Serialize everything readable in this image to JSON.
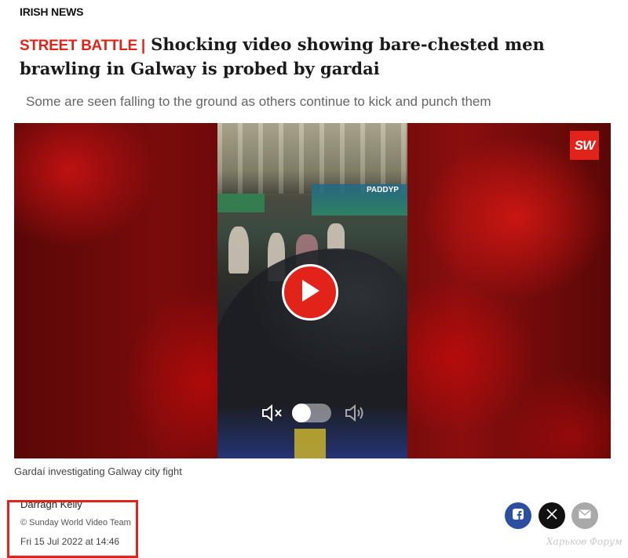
{
  "section": {
    "label": "IRISH NEWS"
  },
  "article": {
    "kicker": "STREET BATTLE |",
    "headline": "Shocking video showing bare-chested men brawling in Galway is probed by gardai",
    "standfirst": "Some are seen falling to the ground as others continue to kick and punch them"
  },
  "video": {
    "logo_text": "SW",
    "sign_text": "PADDYP",
    "caption": "Gardaí investigating Galway city fight",
    "play_icon": "play-icon",
    "mute_icon": "speaker-mute-icon",
    "volume_icon": "speaker-volume-icon",
    "accent_color": "#e2231a"
  },
  "byline": {
    "author": "Darragh Kelly",
    "credit": "© Sunday World Video Team",
    "date": "Fri 15 Jul 2022 at 14:46"
  },
  "share": {
    "facebook_icon": "facebook-icon",
    "x_icon": "x-icon",
    "email_icon": "email-icon"
  },
  "watermark": {
    "text": "Харьков Форум"
  }
}
